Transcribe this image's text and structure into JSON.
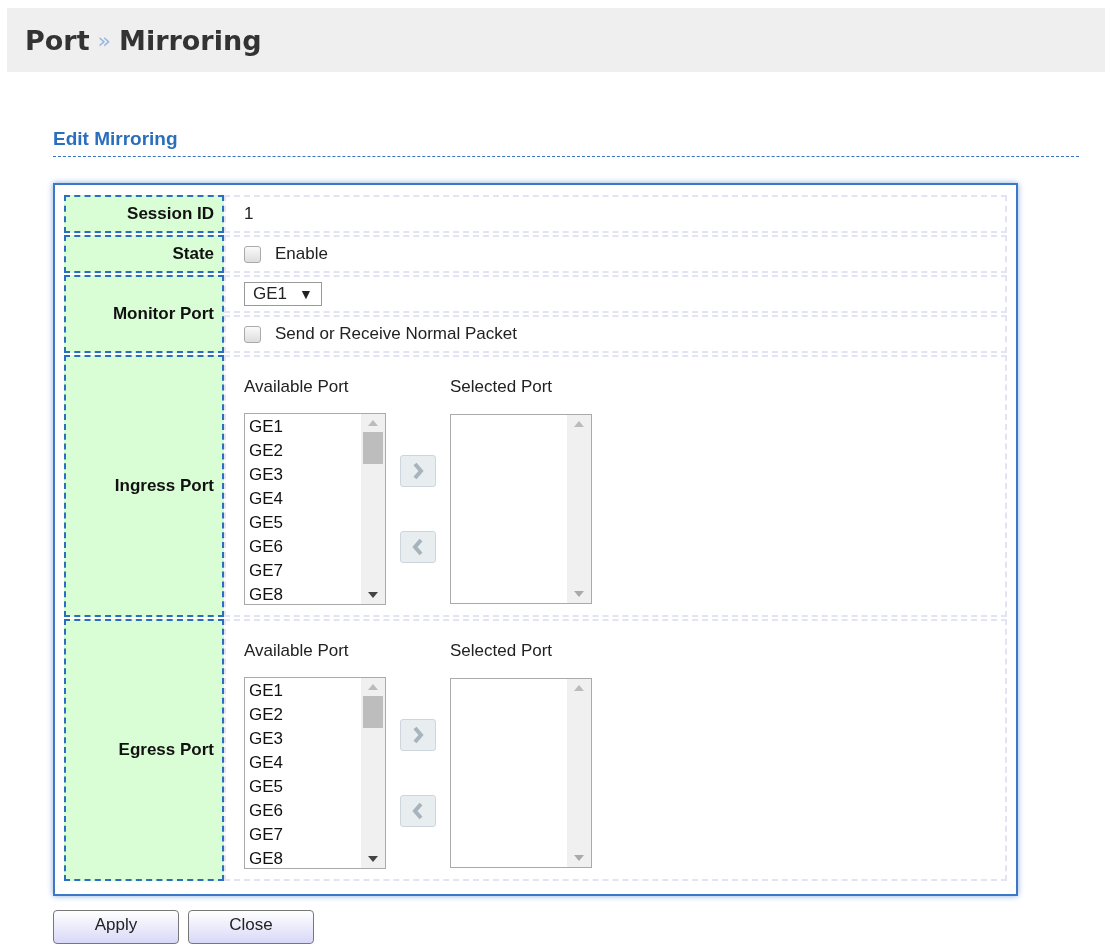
{
  "breadcrumb": {
    "parent": "Port",
    "separator": "»",
    "current": "Mirroring"
  },
  "section_title": "Edit Mirroring",
  "rows": [
    {
      "kind": "text",
      "label": "Session ID",
      "value": "1"
    },
    {
      "kind": "checkbox",
      "label": "State",
      "option": {
        "label": "Enable",
        "checked": false
      }
    },
    {
      "kind": "monitor",
      "label": "Monitor Port",
      "select": {
        "value": "GE1",
        "arrow": "▼"
      },
      "option": {
        "label": "Send or Receive Normal Packet",
        "checked": false
      }
    },
    {
      "kind": "ports",
      "label": "Ingress Port",
      "available_label": "Available Port",
      "selected_label": "Selected Port",
      "available": [
        "GE1",
        "GE2",
        "GE3",
        "GE4",
        "GE5",
        "GE6",
        "GE7",
        "GE8"
      ],
      "selected": []
    },
    {
      "kind": "ports",
      "label": "Egress Port",
      "available_label": "Available Port",
      "selected_label": "Selected Port",
      "available": [
        "GE1",
        "GE2",
        "GE3",
        "GE4",
        "GE5",
        "GE6",
        "GE7",
        "GE8"
      ],
      "selected": []
    }
  ],
  "buttons": [
    "Apply",
    "Close"
  ]
}
